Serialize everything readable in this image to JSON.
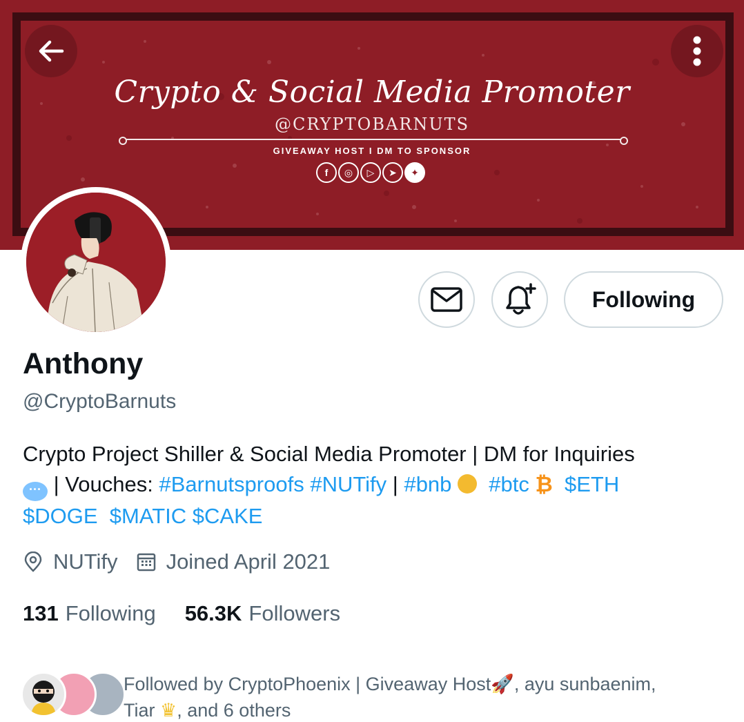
{
  "banner": {
    "title": "Crypto & Social Media Promoter",
    "handle": "@CRYPTOBARNUTS",
    "subtitle": "GIVEAWAY HOST I DM TO SPONSOR",
    "social_icons": [
      "facebook-icon",
      "instagram-icon",
      "youtube-icon",
      "telegram-icon",
      "twitter-icon"
    ],
    "color": "#8e1d26"
  },
  "nav": {
    "back_icon": "arrow-left-icon",
    "more_icon": "more-vertical-icon"
  },
  "actions": {
    "message_icon": "mail-icon",
    "notify_icon": "bell-plus-icon",
    "following_label": "Following"
  },
  "profile": {
    "name": "Anthony",
    "handle": "@CryptoBarnuts",
    "bio": {
      "line1": "Crypto Project Shiller & Social Media Promoter | DM for Inquiries",
      "vouches_prefix": "| Vouches:",
      "tag_proofs": "#Barnutsproofs",
      "tag_nutify": "#NUTify",
      "sep": "|",
      "tag_bnb": "#bnb",
      "tag_btc": "#btc",
      "btc_symbol": "₿",
      "tag_eth": "$ETH",
      "tag_doge": "$DOGE",
      "tag_matic": "$MATIC",
      "tag_cake": "$CAKE"
    },
    "location": "NUTify",
    "joined": "Joined April 2021"
  },
  "stats": {
    "following_count": "131",
    "following_label": "Following",
    "followers_count": "56.3K",
    "followers_label": "Followers"
  },
  "followed_by": {
    "line1": "Followed by CryptoPhoenix | Giveaway Host",
    "line1_after": ", ayu sunbaenim,",
    "line2_name": "Tiar",
    "line2_after": ", and 6 others"
  },
  "colors": {
    "link": "#1d9bf0",
    "secondary_text": "#536471",
    "primary_text": "#0f1419",
    "border": "#cfd9de"
  }
}
